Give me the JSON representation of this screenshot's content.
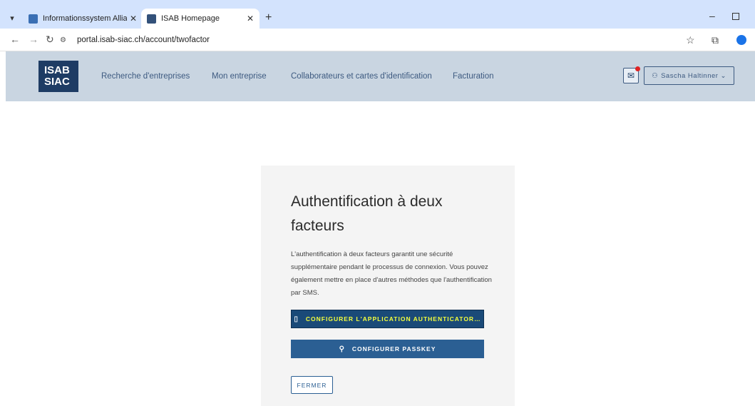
{
  "browser": {
    "tabs": [
      {
        "title": "Informationssystem Allianz Bau",
        "active": false
      },
      {
        "title": "ISAB Homepage",
        "active": true
      }
    ],
    "new_tab_icon": "plus-icon",
    "url": "portal.isab-siac.ch/account/twofactor"
  },
  "header": {
    "logo_line1": "ISAB",
    "logo_line2": "SIAC",
    "nav": [
      "Recherche d'entreprises",
      "Mon entreprise",
      "Collaborateurs et cartes d'identification",
      "Facturation"
    ],
    "user_name": "Sascha Haltinner"
  },
  "card": {
    "title": "Authentification à deux facteurs",
    "description": "L'authentification à deux facteurs garantit une sécurité supplémentaire pendant le processus de connexion. Vous pouvez également mettre en place d'autres méthodes que l'authentification par SMS.",
    "btn_authenticator": "CONFIGURER L'APPLICATION AUTHENTICATOR…",
    "btn_passkey": "CONFIGURER PASSKEY",
    "btn_close": "FERMER"
  },
  "colors": {
    "header_bg": "#c9d5e1",
    "brand": "#1e3c64",
    "button": "#2b5f93",
    "highlight_text": "#f5ff3c"
  }
}
